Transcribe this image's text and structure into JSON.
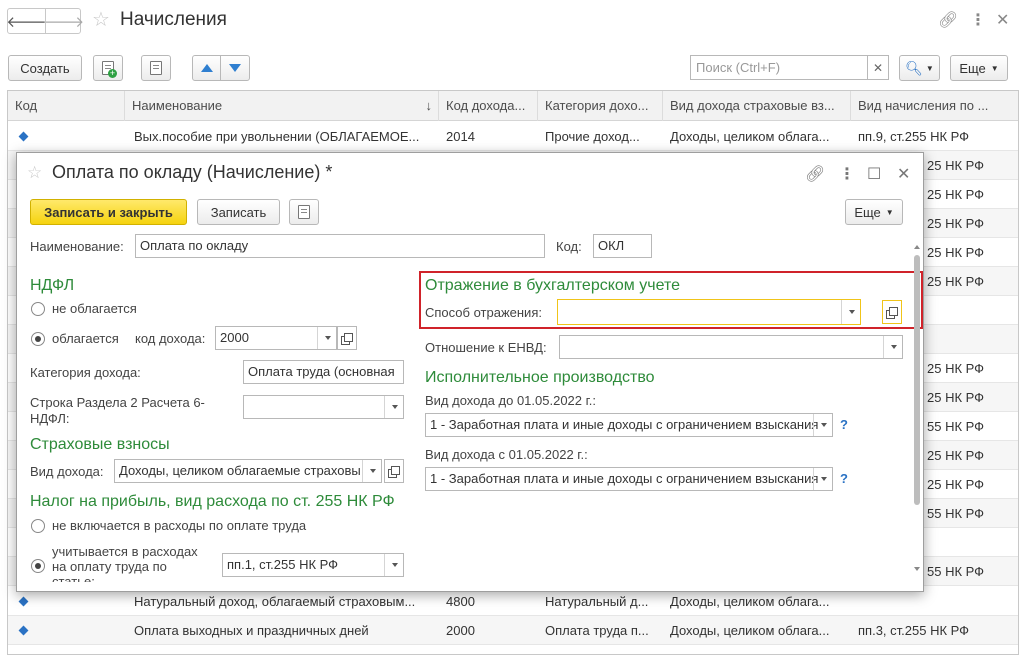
{
  "window": {
    "title": "Начисления",
    "back_icon": "arrow-left-icon",
    "forward_icon": "arrow-right-icon"
  },
  "toolbar": {
    "create_label": "Создать",
    "more_label": "Еще",
    "search_placeholder": "Поиск (Ctrl+F)"
  },
  "table": {
    "columns": [
      "Код",
      "Наименование",
      "Код дохода...",
      "Категория дохо...",
      "Вид дохода страховые вз...",
      "Вид начисления по ..."
    ],
    "sort_indicator": "↓",
    "top_rows": [
      {
        "name": "Вых.пособие при увольнении (ОБЛАГАЕМОЕ...",
        "income_code": "2014",
        "category": "Прочие доход...",
        "insurance_type": "Доходы, целиком облага...",
        "accrual_type": "пп.9, ст.255 НК РФ"
      }
    ],
    "hidden_right_cells": [
      "25 НК РФ",
      "25 НК РФ",
      "25 НК РФ",
      "25 НК РФ",
      "25 НК РФ",
      "",
      "",
      "25 НК РФ",
      "25 НК РФ",
      "55 НК РФ",
      "25 НК РФ",
      "25 НК РФ",
      "55 НК РФ",
      "",
      "55 НК РФ"
    ],
    "bottom_rows": [
      {
        "name": "Натуральный доход, облагаемый страховым...",
        "income_code": "4800",
        "category": "Натуральный д...",
        "insurance_type": "Доходы, целиком облага...",
        "accrual_type": ""
      },
      {
        "name": "Оплата выходных и праздничных дней",
        "income_code": "2000",
        "category": "Оплата труда п...",
        "insurance_type": "Доходы, целиком облага...",
        "accrual_type": "пп.3, ст.255 НК РФ"
      }
    ]
  },
  "dialog": {
    "title": "Оплата по окладу (Начисление) *",
    "save_close_label": "Записать и закрыть",
    "save_label": "Записать",
    "more_label": "Еще",
    "name_label": "Наименование:",
    "name_value": "Оплата по окладу",
    "code_label": "Код:",
    "code_value": "ОКЛ",
    "ndfl": {
      "title": "НДФЛ",
      "not_taxed_label": "не облагается",
      "taxed_label": "облагается",
      "income_code_label": "код дохода:",
      "income_code_value": "2000",
      "category_label": "Категория дохода:",
      "category_value": "Оплата труда (основная",
      "row_label_1": "Строка Раздела 2 Расчета 6-",
      "row_label_2": "НДФЛ:",
      "row_value": ""
    },
    "insurance": {
      "title": "Страховые взносы",
      "income_type_label": "Вид дохода:",
      "income_type_value": "Доходы, целиком облагаемые страховы"
    },
    "profit_tax": {
      "title": "Налог на прибыль, вид расхода по ст. 255 НК РФ",
      "not_included_label": "не включается в расходы по оплате труда",
      "included_label_1": "учитывается в расходах",
      "included_label_2": "на оплату труда по",
      "included_label_3": "статье:",
      "article_value": "пп.1, ст.255 НК РФ"
    },
    "accounting": {
      "title": "Отражение в бухгалтерском учете",
      "method_label": "Способ отражения:",
      "method_value": "",
      "envd_label": "Отношение к ЕНВД:",
      "envd_value": ""
    },
    "enforcement": {
      "title": "Исполнительное производство",
      "before_label": "Вид дохода до 01.05.2022 г.:",
      "before_value": "1 - Заработная плата и иные доходы с ограничением взыскания",
      "after_label": "Вид дохода с 01.05.2022 г.:",
      "after_value": "1 - Заработная плата и иные доходы с ограничением взыскания",
      "help_label": "?"
    }
  },
  "colors": {
    "section_green": "#2e8b3a",
    "primary_yellow": "#f5d30f",
    "highlight_red": "#d0232a",
    "focus_yellow": "#f0c419"
  }
}
